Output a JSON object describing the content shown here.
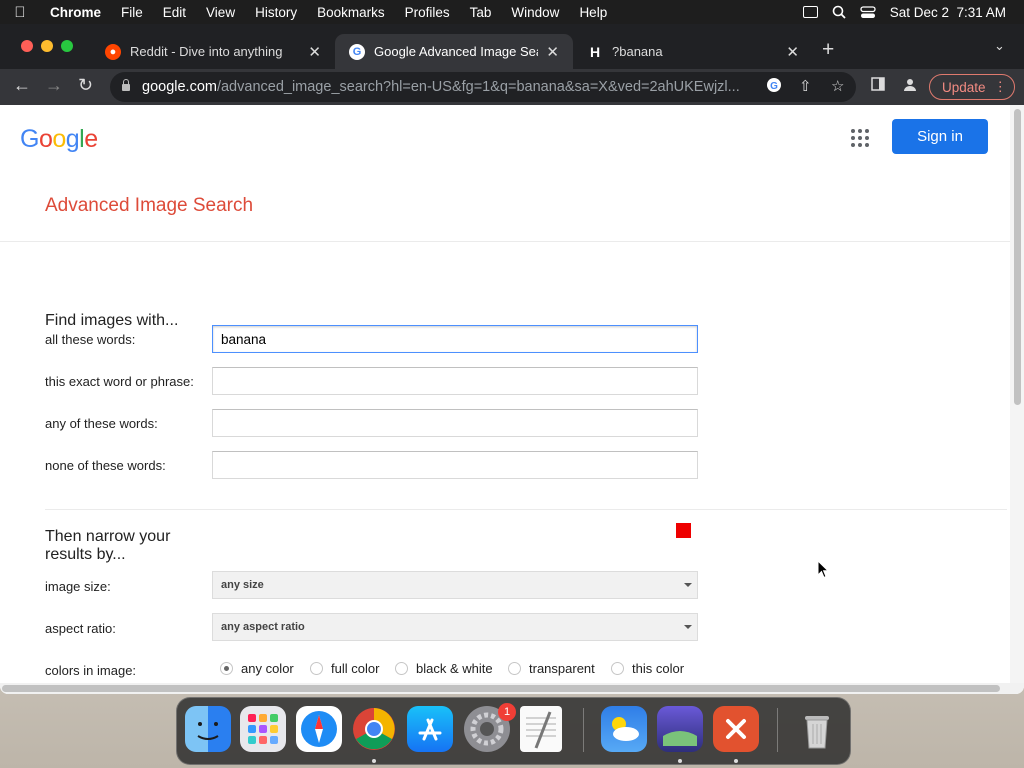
{
  "menubar": {
    "app_name": "Chrome",
    "items": [
      "File",
      "Edit",
      "View",
      "History",
      "Bookmarks",
      "Profiles",
      "Tab",
      "Window",
      "Help"
    ],
    "clock": "Sat Dec 2  7:31 AM"
  },
  "tabs": [
    {
      "title": "Reddit - Dive into anything",
      "active": false
    },
    {
      "title": "Google Advanced Image Search",
      "active": true
    },
    {
      "title": "?banana",
      "favicon_letter": "H",
      "active": false
    }
  ],
  "address_bar": {
    "domain": "google.com",
    "path": "/advanced_image_search?hl=en-US&fg=1&q=banana&sa=X&ved=2ahUKEwjzl...",
    "update_label": "Update"
  },
  "page": {
    "logo_letters": [
      {
        "ch": "G",
        "color": "#4285f4"
      },
      {
        "ch": "o",
        "color": "#ea4335"
      },
      {
        "ch": "o",
        "color": "#fbbc05"
      },
      {
        "ch": "g",
        "color": "#4285f4"
      },
      {
        "ch": "l",
        "color": "#34a853"
      },
      {
        "ch": "e",
        "color": "#ea4335"
      }
    ],
    "signin_label": "Sign in",
    "title": "Advanced Image Search",
    "find_heading": "Find images with...",
    "fields": {
      "all_words": {
        "label": "all these words:",
        "value": "banana"
      },
      "exact_phrase": {
        "label": "this exact word or phrase:",
        "value": ""
      },
      "any_words": {
        "label": "any of these words:",
        "value": ""
      },
      "none_words": {
        "label": "none of these words:",
        "value": ""
      }
    },
    "narrow_heading_1": "Then narrow your",
    "narrow_heading_2": "results by...",
    "image_size": {
      "label": "image size:",
      "value": "any size"
    },
    "aspect_ratio": {
      "label": "aspect ratio:",
      "value": "any aspect ratio"
    },
    "colors": {
      "label": "colors in image:",
      "options": [
        "any color",
        "full color",
        "black & white",
        "transparent",
        "this color"
      ],
      "selected": "any color",
      "swatch_color": "#ee0000"
    }
  },
  "dock": {
    "apps": [
      "finder",
      "launchpad",
      "safari",
      "chrome",
      "app-store",
      "system-settings",
      "textedit",
      "weather",
      "preview",
      "remote-desktop",
      "trash"
    ],
    "settings_badge": "1"
  },
  "colors": {
    "link_title": "#dd4b39",
    "signin_blue": "#1a73e8"
  }
}
